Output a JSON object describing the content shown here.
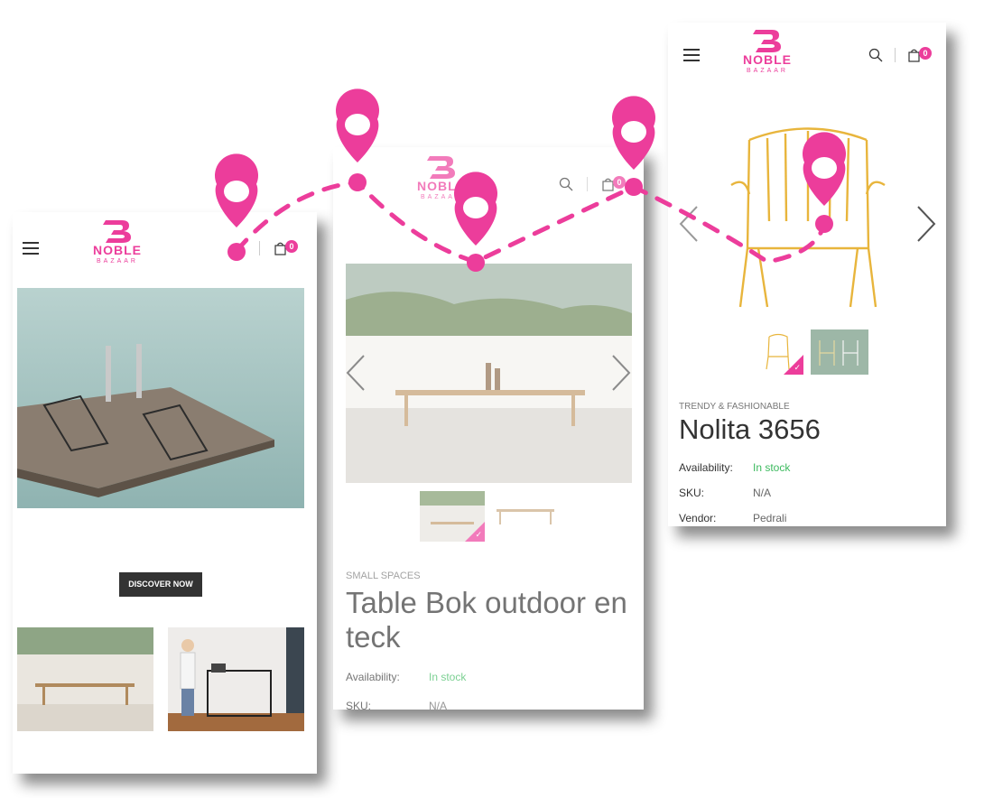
{
  "brand": {
    "name": "NOBLE",
    "sub": "BAZAAR",
    "color": "#ec3d9b"
  },
  "cart": {
    "count": "0"
  },
  "home": {
    "discover_label": "DISCOVER NOW",
    "cut_heading": "··· · ··· ·· ·"
  },
  "product1": {
    "vendor_label": "SMALL SPACES",
    "title": "Table Bok outdoor en teck",
    "availability_label": "Availability:",
    "availability_value": "In stock",
    "sku_label": "SKU:",
    "sku_value": "N/A"
  },
  "product2": {
    "vendor_label": "TRENDY & FASHIONABLE",
    "title": "Nolita 3656",
    "availability_label": "Availability:",
    "availability_value": "In stock",
    "sku_label": "SKU:",
    "sku_value": "N/A",
    "vendor_row_label": "Vendor:",
    "vendor_row_value": "Pedrali"
  },
  "colors": {
    "accent": "#ec3d9b",
    "in_stock": "#3dba5f",
    "dark_button": "#333333"
  }
}
